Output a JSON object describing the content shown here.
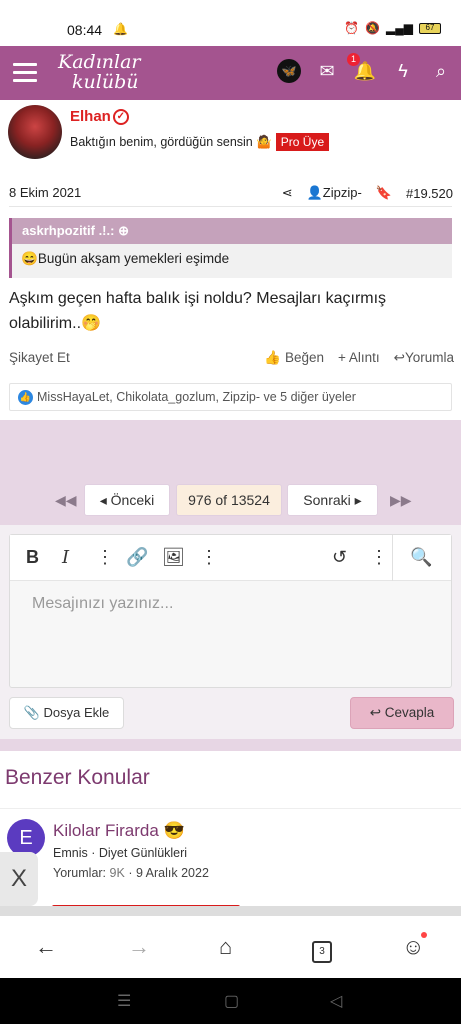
{
  "status_bar": {
    "time": "08:44",
    "battery": "67"
  },
  "header": {
    "logo_line1": "Kadınlar",
    "logo_line2": "kulübü",
    "notification_count": "1"
  },
  "post": {
    "username": "Elhan",
    "signature": "Baktığın benim, gördüğün sensin 🤷",
    "badge": "Pro Üye",
    "date": "8 Ekim 2021",
    "author_link": "Zipzip-",
    "post_number": "#19.520",
    "quote_author": "askrhpozitif .!.:",
    "quote_text": "Bugün akşam yemekleri eşimde",
    "quote_emoji": "😄",
    "message": "Aşkım geçen hafta balık işi noldu? Mesajları kaçırmış olabilirim..",
    "message_emoji": "🤭",
    "report": "Şikayet Et",
    "like": "Beğen",
    "quote_action": "Alıntı",
    "comment": "Yorumla",
    "likes_text": "MissHayaLet, Chikolata_gozlum, Zipzip- ve 5 diğer üyeler"
  },
  "pager": {
    "prev": "Önceki",
    "current": "976 of 13524",
    "next": "Sonraki"
  },
  "editor": {
    "placeholder": "Mesajınızı yazınız...",
    "attach": "Dosya Ekle",
    "reply": "Cevapla"
  },
  "similar": {
    "title": "Benzer Konular",
    "item": {
      "avatar_letter": "E",
      "title": "Kilolar Firarda",
      "title_emoji": "😎",
      "meta": "Emnis · Diyet Günlükleri",
      "replies_label": "Yorumlar:",
      "replies": "9K",
      "date": "· 9 Aralık 2022"
    },
    "close": "X"
  },
  "browser": {
    "tab_count": "3"
  }
}
